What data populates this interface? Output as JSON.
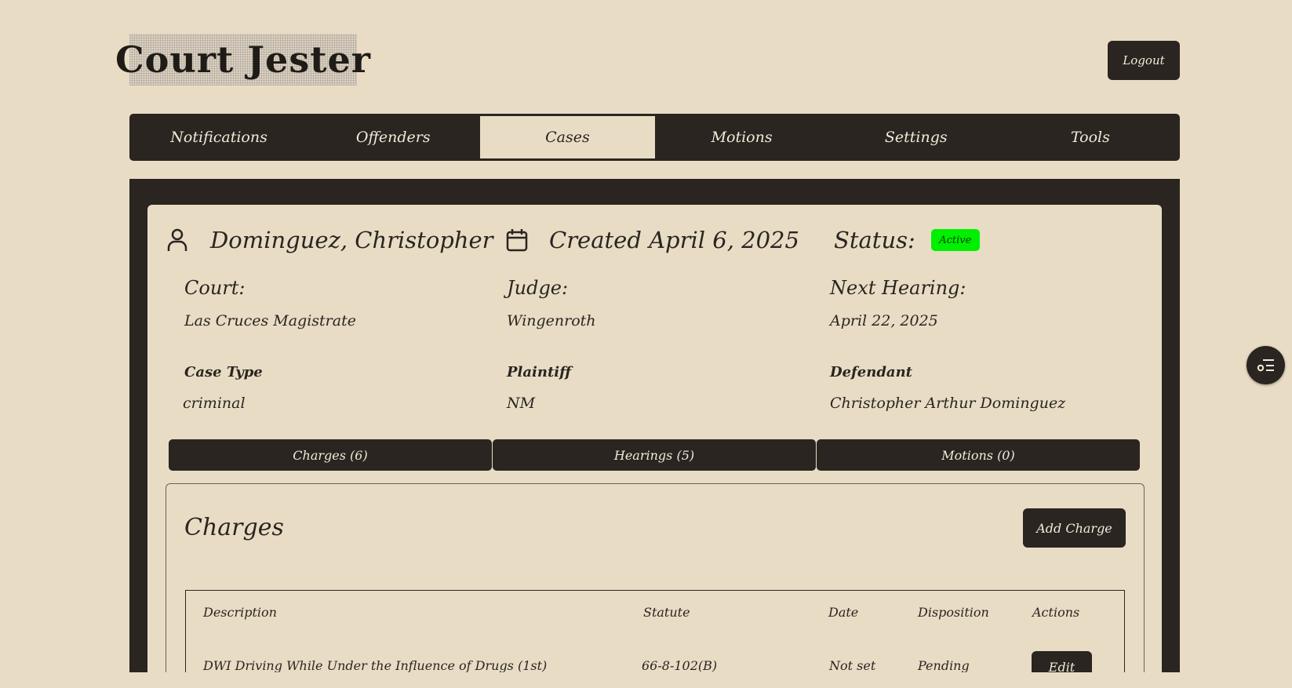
{
  "app": {
    "logo_text": "Court Jester",
    "logout_label": "Logout"
  },
  "nav": {
    "items": [
      {
        "label": "Notifications"
      },
      {
        "label": "Offenders"
      },
      {
        "label": "Cases"
      },
      {
        "label": "Motions"
      },
      {
        "label": "Settings"
      },
      {
        "label": "Tools"
      }
    ],
    "active": "Cases"
  },
  "case": {
    "name": "Dominguez, Christopher",
    "created": "Created April 6, 2025",
    "status_label": "Status:",
    "status_value": "Active",
    "status_color": "#00f000",
    "court_label": "Court:",
    "court_value": "Las Cruces Magistrate",
    "judge_label": "Judge:",
    "judge_value": "Wingenroth",
    "next_hearing_label": "Next Hearing:",
    "next_hearing_value": "April 22, 2025",
    "case_type_label": "Case Type",
    "case_type_value": "criminal",
    "plaintiff_label": "Plaintiff",
    "plaintiff_value": "NM",
    "defendant_label": "Defendant",
    "defendant_value": "Christopher Arthur Dominguez"
  },
  "tabs": [
    {
      "label": "Charges (6)"
    },
    {
      "label": "Hearings (5)"
    },
    {
      "label": "Motions (0)"
    }
  ],
  "charges": {
    "title": "Charges",
    "add_label": "Add Charge",
    "columns": [
      "Description",
      "Statute",
      "Date",
      "Disposition",
      "Actions"
    ],
    "rows": [
      {
        "description": "DWI Driving While Under the Influence of Drugs (1st)",
        "statute": "66-8-102(B)",
        "date": "Not set",
        "disposition": "Pending",
        "action": "Edit"
      }
    ]
  },
  "theme": {
    "dark": "#2a2520",
    "background": "#e9dcc5",
    "light_text": "#f2ead9"
  },
  "icons": {
    "user": "user-icon",
    "calendar": "calendar-icon",
    "fab": "filter-list-icon"
  }
}
